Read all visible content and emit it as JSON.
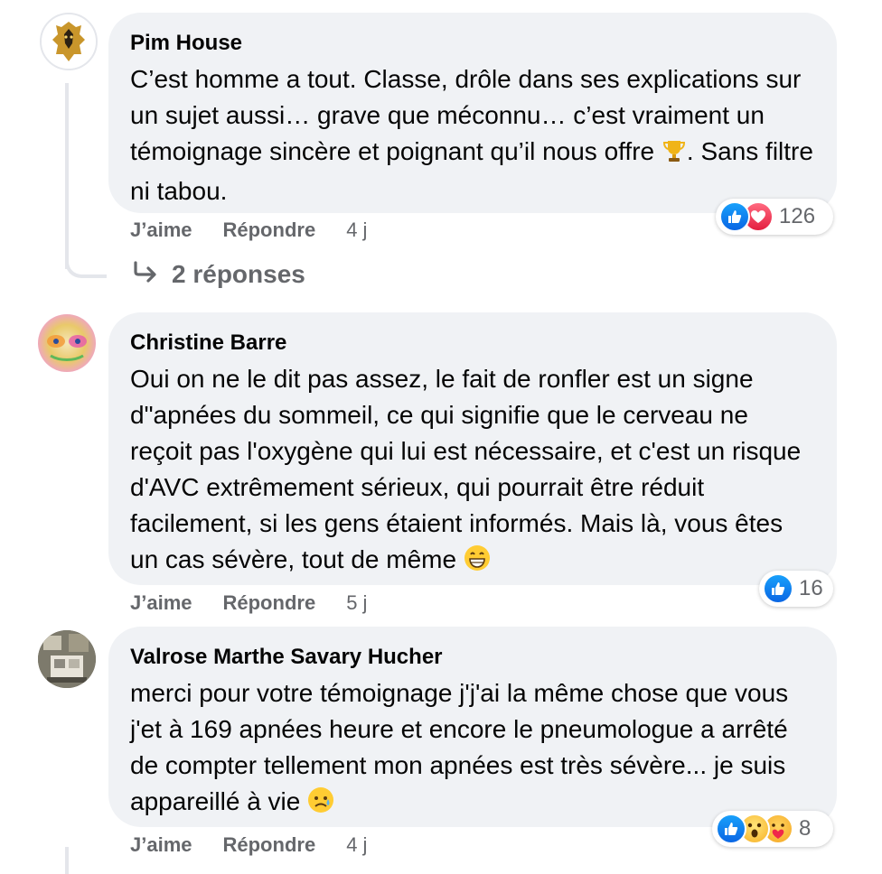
{
  "comments": [
    {
      "author": "Pim House",
      "text": "C’est homme a tout. Classe, drôle dans ses explications sur un sujet aussi… grave que méconnu… c’est vraiment un témoignage sincère et poignant qu’il nous offre",
      "text_after_emoji": ". Sans filtre ni tabou.",
      "emoji": "trophy-emoji",
      "like_label": "J’aime",
      "reply_label": "Répondre",
      "time": "4 j",
      "reactions": [
        "like-icon",
        "love-icon"
      ],
      "reaction_count": "126"
    },
    {
      "author": "Christine Barre",
      "text": "Oui on ne le dit pas assez, le fait de ronfler est un signe d\"apnées du sommeil, ce qui signifie que le cerveau ne reçoit pas l'oxygène qui lui est nécessaire, et c'est un risque d'AVC extrêmement sérieux, qui pourrait être réduit facilement, si les gens étaient informés. Mais là, vous êtes un cas sévère, tout de même",
      "emoji": "grinning-emoji",
      "like_label": "J’aime",
      "reply_label": "Répondre",
      "time": "5 j",
      "reactions": [
        "like-icon"
      ],
      "reaction_count": "16"
    },
    {
      "author": "Valrose Marthe Savary Hucher",
      "text": "merci pour votre témoignage j'j'ai la même chose que vous j'et à 169 apnées heure et encore le pneumologue a arrêté de compter tellement mon apnées est très sévère... je suis appareillé à vie",
      "emoji": "sad-relieved-emoji",
      "like_label": "J’aime",
      "reply_label": "Répondre",
      "time": "4 j",
      "reactions": [
        "like-icon",
        "wow-icon",
        "care-icon"
      ],
      "reaction_count": "8"
    }
  ],
  "replies_link": "2 réponses",
  "colors": {
    "bubble": "#f0f2f5",
    "secondary_text": "#65676b",
    "like_blue": "#0a66e4",
    "love_red": "#e41e3f"
  }
}
